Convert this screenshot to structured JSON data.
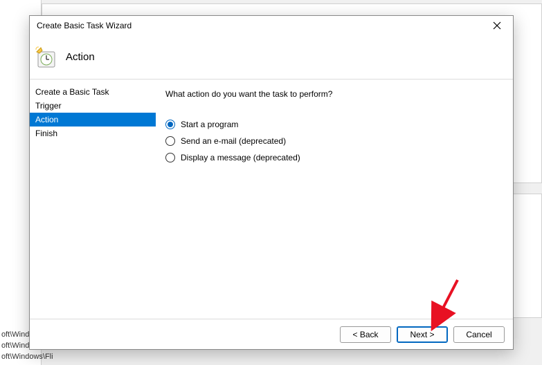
{
  "background": {
    "path1": "oft\\Windo",
    "path2": "oft\\Windows\\U...",
    "path3": "oft\\Windows\\Fli"
  },
  "dialog": {
    "title": "Create Basic Task Wizard",
    "header": {
      "title": "Action"
    },
    "nav": {
      "items": [
        {
          "label": "Create a Basic Task",
          "selected": false
        },
        {
          "label": "Trigger",
          "selected": false
        },
        {
          "label": "Action",
          "selected": true
        },
        {
          "label": "Finish",
          "selected": false
        }
      ]
    },
    "content": {
      "prompt": "What action do you want the task to perform?",
      "options": [
        {
          "label": "Start a program",
          "checked": true
        },
        {
          "label": "Send an e-mail (deprecated)",
          "checked": false
        },
        {
          "label": "Display a message (deprecated)",
          "checked": false
        }
      ]
    },
    "footer": {
      "back": "< Back",
      "next": "Next >",
      "cancel": "Cancel"
    }
  }
}
